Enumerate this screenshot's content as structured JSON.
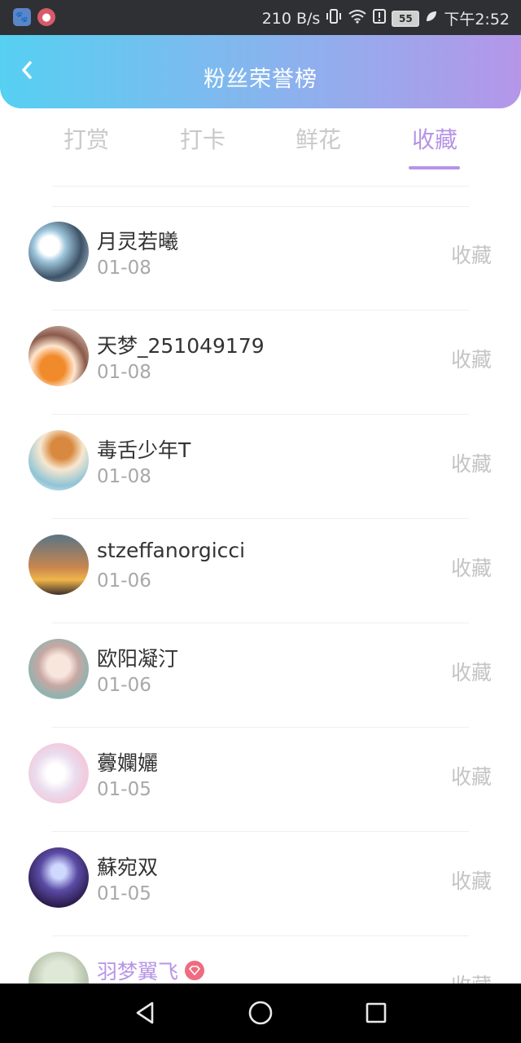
{
  "status_bar": {
    "net_speed": "210 B/s",
    "battery": "55",
    "time": "下午2:52",
    "icons": [
      "paw-app-icon",
      "app-badge-icon",
      "vibrate-icon",
      "wifi-icon",
      "alert-icon",
      "battery-icon",
      "leaf-icon"
    ]
  },
  "header": {
    "title": "粉丝荣誉榜",
    "back_icon": "chevron-left-icon",
    "colors": {
      "gradient_start": "#56d0f2",
      "gradient_end": "#b596e9"
    }
  },
  "tabs": [
    {
      "label": "打赏",
      "active": false
    },
    {
      "label": "打卡",
      "active": false
    },
    {
      "label": "鲜花",
      "active": false
    },
    {
      "label": "收藏",
      "active": true
    }
  ],
  "accent_color": "#b694e6",
  "list": [
    {
      "name": "月灵若曦",
      "date": "01-08",
      "action": "收藏"
    },
    {
      "name": "天梦_251049179",
      "date": "01-08",
      "action": "收藏"
    },
    {
      "name": "毒舌少年T",
      "date": "01-08",
      "action": "收藏"
    },
    {
      "name": "stzeffanorgicci",
      "date": "01-06",
      "action": "收藏"
    },
    {
      "name": "欧阳凝汀",
      "date": "01-06",
      "action": "收藏"
    },
    {
      "name": "虋孄孋",
      "date": "01-05",
      "action": "收藏"
    },
    {
      "name": "蘇宛双",
      "date": "01-05",
      "action": "收藏"
    },
    {
      "name": "羽梦翼飞",
      "date": "",
      "action": "收藏",
      "vip": true
    }
  ],
  "nav_bar": {
    "icons": [
      "back-triangle-icon",
      "home-circle-icon",
      "recents-square-icon"
    ]
  }
}
